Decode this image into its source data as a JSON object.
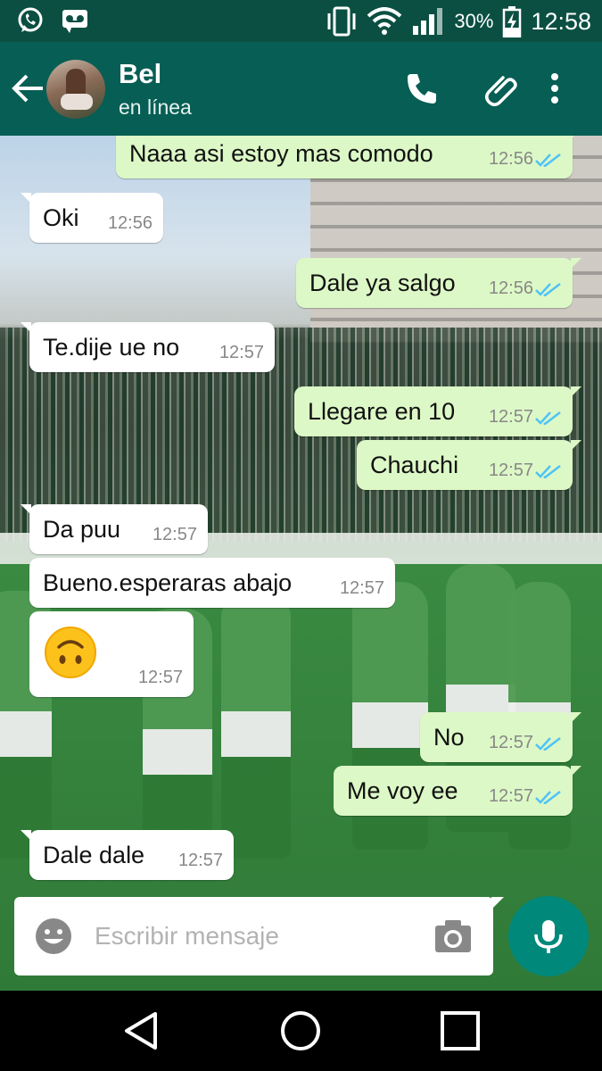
{
  "status_bar": {
    "battery_percent": "30%",
    "time": "12:58",
    "icons": [
      "whatsapp-icon",
      "voicemail-icon",
      "vibrate-icon",
      "wifi-icon",
      "signal-icon",
      "battery-charging-icon"
    ]
  },
  "header": {
    "contact_name": "Bel",
    "status": "en línea",
    "icons": [
      "back-arrow-icon",
      "avatar",
      "phone-icon",
      "attachment-icon",
      "more-vert-icon"
    ]
  },
  "messages": [
    {
      "dir": "out",
      "text": "Naaa asi estoy mas comodo",
      "time": "12:56",
      "read": true
    },
    {
      "dir": "in",
      "text": "Oki",
      "time": "12:56"
    },
    {
      "dir": "out",
      "text": "Dale ya salgo",
      "time": "12:56",
      "read": true
    },
    {
      "dir": "in",
      "text": "Te.dije ue no",
      "time": "12:57"
    },
    {
      "dir": "out",
      "text": "Llegare en 10",
      "time": "12:57",
      "read": true
    },
    {
      "dir": "out",
      "text": "Chauchi",
      "time": "12:57",
      "read": true
    },
    {
      "dir": "in",
      "text": "Da puu",
      "time": "12:57"
    },
    {
      "dir": "in",
      "text": "Bueno.esperaras abajo",
      "time": "12:57"
    },
    {
      "dir": "in",
      "text": "",
      "emoji": "upside-down-face",
      "time": "12:57"
    },
    {
      "dir": "out",
      "text": "No",
      "time": "12:57",
      "read": true
    },
    {
      "dir": "out",
      "text": "Me voy ee",
      "time": "12:57",
      "read": true
    },
    {
      "dir": "in",
      "text": "Dale dale",
      "time": "12:57"
    }
  ],
  "input": {
    "placeholder": "Escribir mensaje"
  },
  "colors": {
    "header": "#075e54",
    "status_bar": "#0b4f42",
    "outgoing_bubble": "#dcf8c6",
    "incoming_bubble": "#ffffff",
    "read_ticks": "#4fc3f7",
    "mic_button": "#00897b"
  }
}
